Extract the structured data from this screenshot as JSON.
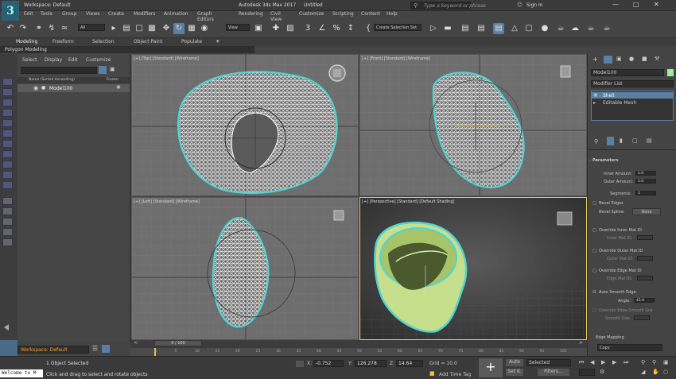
{
  "window": {
    "workspace": "Workspace: Default",
    "title": "Autodesk 3ds Max 2017",
    "doc_title": "Untitled",
    "search_placeholder": "Type a keyword or phrase",
    "sign_in": "Sign In"
  },
  "menus": [
    "Edit",
    "Tools",
    "Group",
    "Views",
    "Create",
    "Modifiers",
    "Animation",
    "Graph Editors",
    "Rendering",
    "Civil View",
    "Customize",
    "Scripting",
    "Content",
    "Help"
  ],
  "toolbar": {
    "selection_filter": "All",
    "ref_coord": "View",
    "named_selection": "Create Selection Set"
  },
  "ribbon": {
    "tabs": [
      "Modeling",
      "Freeform",
      "Selection",
      "Object Paint",
      "Populate"
    ],
    "sub": "Polygon Modeling"
  },
  "explorer": {
    "tabs": [
      "Select",
      "Display",
      "Edit",
      "Customize"
    ],
    "col_name": "Name (Sorted Ascending)",
    "col_frozen": "Frozen",
    "item": "Model100",
    "workspace": "Workspace: Default"
  },
  "viewports": {
    "top": "[+] [Top] [Standard] [Wireframe]",
    "front": "[+] [Front] [Standard] [Wireframe]",
    "left": "[+] [Left] [Standard] [Wireframe]",
    "persp": "[+] [Perspective] [Standard] [Default Shading]"
  },
  "command_panel": {
    "object_name": "Model100",
    "modifier_list": "Modifier List",
    "stack": [
      "Shell",
      "Editable Mesh"
    ],
    "rollout": "Parameters",
    "inner_amount_label": "Inner Amount:",
    "inner_amount": "1.0",
    "outer_amount_label": "Outer Amount:",
    "outer_amount": "1.0",
    "segments_label": "Segments:",
    "segments": "1",
    "bevel_edges": "Bevel Edges",
    "bevel_spline_label": "Bevel Spline:",
    "bevel_spline": "None",
    "override_inner": "Override Inner Mat ID",
    "inner_mat_label": "Inner Mat ID:",
    "override_outer": "Override Outer Mat ID",
    "outer_mat_label": "Outer Mat ID:",
    "override_edge": "Override Edge Mat ID",
    "edge_mat_label": "Edge Mat ID:",
    "auto_smooth": "Auto Smooth Edge",
    "angle_label": "Angle:",
    "angle": "45.0",
    "override_edge_smooth": "Override Edge Smooth Grp",
    "smooth_grp_label": "Smooth Grp:",
    "edge_mapping_label": "Edge Mapping",
    "edge_mapping": "Copy"
  },
  "timeline": {
    "frame": "0 / 100",
    "ticks": [
      "0",
      "5",
      "10",
      "15",
      "20",
      "25",
      "30",
      "35",
      "40",
      "45",
      "50",
      "55",
      "60",
      "65",
      "70",
      "75",
      "80",
      "85",
      "90",
      "95",
      "100"
    ]
  },
  "status": {
    "maxscript": "Welcome to M",
    "selected": "1 Object Selected",
    "prompt": "Click and drag to select and rotate objects",
    "x_label": "X:",
    "x": "-0.752",
    "y_label": "Y:",
    "y": "126.278",
    "z_label": "Z:",
    "z": "14.64",
    "grid": "Grid = 10.0",
    "add_time_tag": "Add Time Tag",
    "auto": "Auto",
    "set_key": "Set K.",
    "selected_dd": "Selected",
    "filters": "Filters..."
  }
}
